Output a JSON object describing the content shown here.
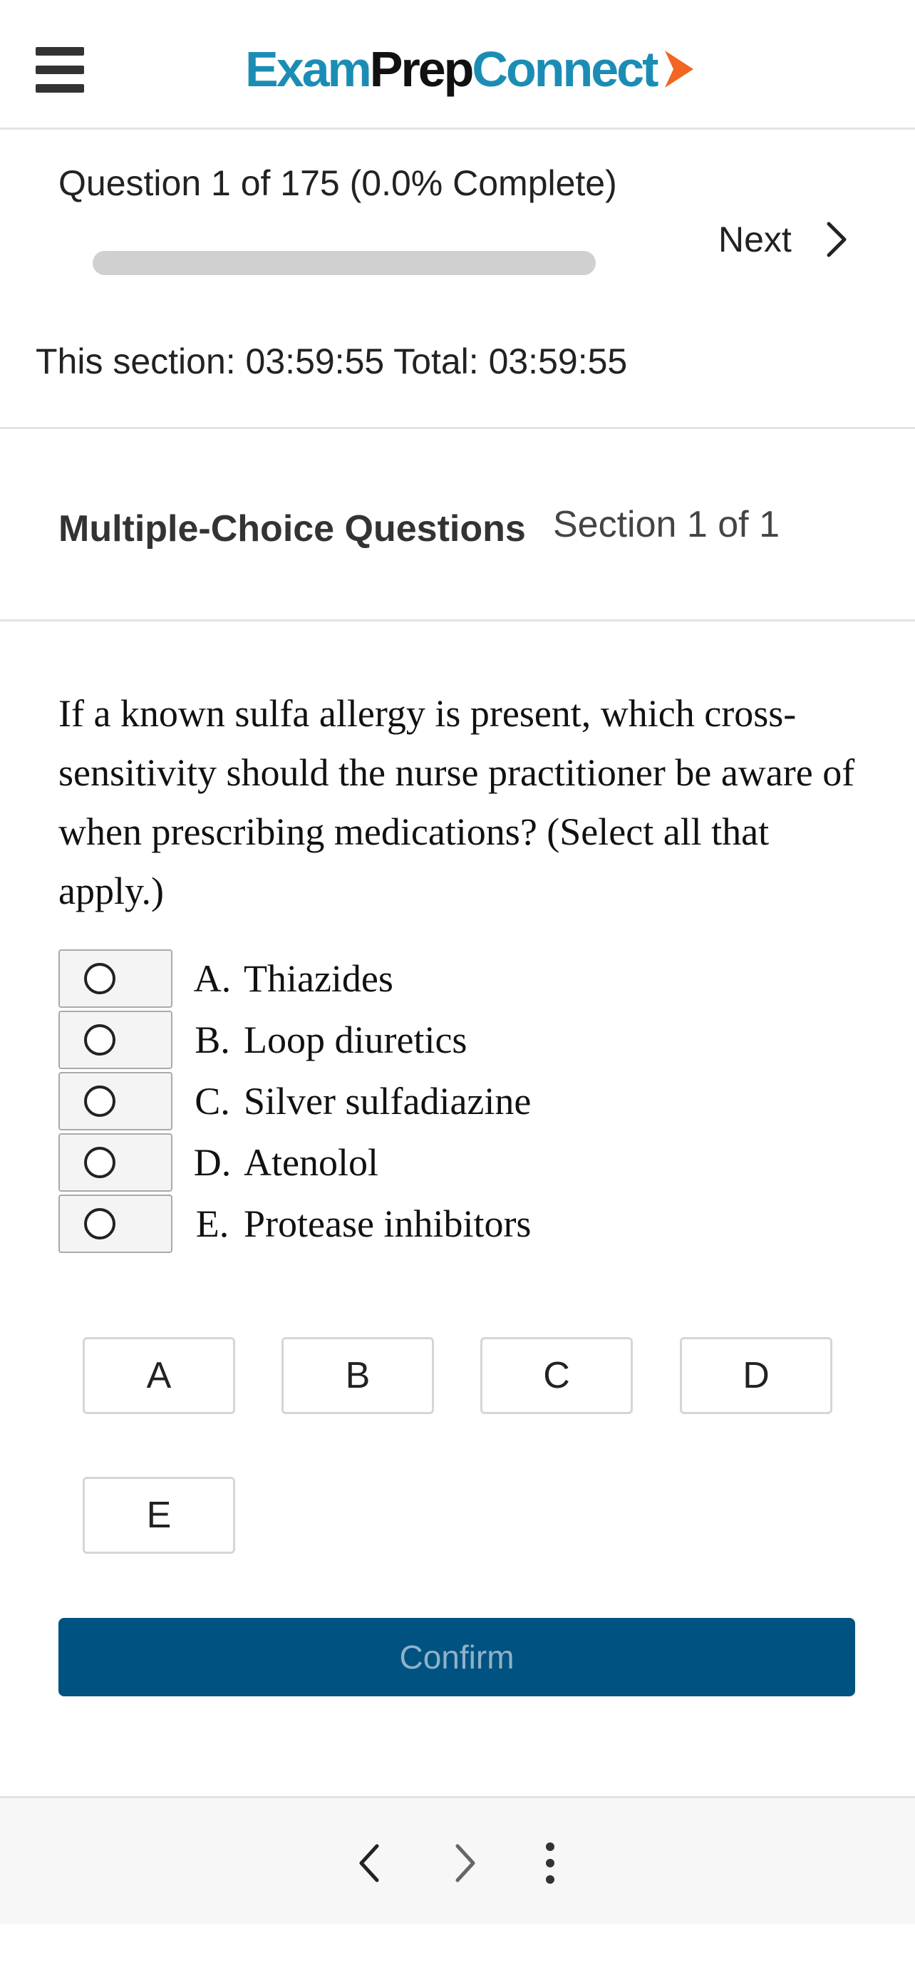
{
  "header": {
    "logo": {
      "part1": "Exam",
      "part2": "Prep",
      "part3": "Connect"
    },
    "menu_icon": "hamburger-menu-icon"
  },
  "progress": {
    "question_counter": "Question 1 of 175 (0.0% Complete)",
    "percent_complete": 0.0,
    "next_label": "Next",
    "timer": "This section: 03:59:55 Total: 03:59:55"
  },
  "section": {
    "title": "Multiple-Choice Questions",
    "count": "Section 1 of 1"
  },
  "question": {
    "text": "If a known sulfa allergy is present, which cross-sensitivity should the nurse practitioner be aware of when prescribing medications? (Select all that apply.)",
    "options": [
      {
        "letter": "A.",
        "text": "Thiazides"
      },
      {
        "letter": "B.",
        "text": "Loop diuretics"
      },
      {
        "letter": "C.",
        "text": "Silver sulfadiazine"
      },
      {
        "letter": "D.",
        "text": "Atenolol"
      },
      {
        "letter": "E.",
        "text": "Protease inhibitors"
      }
    ]
  },
  "answer_buttons": [
    "A",
    "B",
    "C",
    "D",
    "E"
  ],
  "confirm_label": "Confirm",
  "colors": {
    "brand_blue": "#1b8db5",
    "confirm_bg": "#005280",
    "logo_arrow": "#f26522"
  },
  "bottom_nav": {
    "back_icon": "chevron-left-icon",
    "forward_icon": "chevron-right-icon",
    "more_icon": "more-vertical-icon"
  }
}
